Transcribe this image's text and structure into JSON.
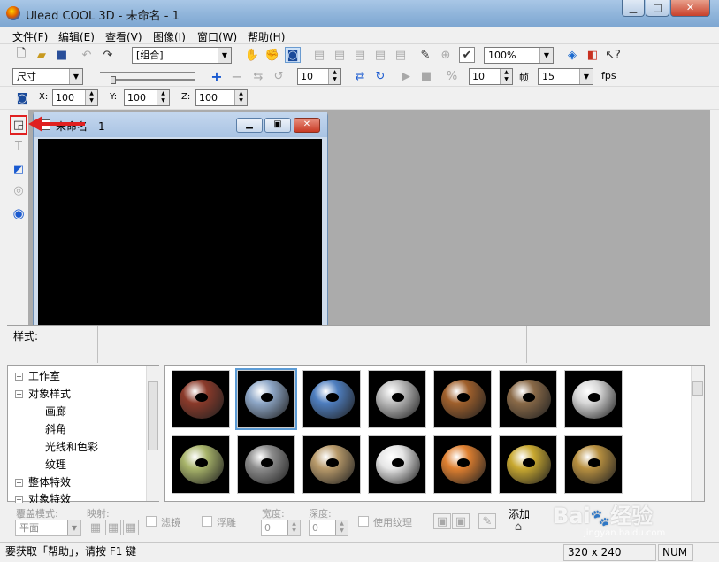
{
  "window": {
    "title": "Ulead COOL 3D - 未命名 - 1"
  },
  "menu": [
    "文件(F)",
    "编辑(E)",
    "查看(V)",
    "图像(I)",
    "窗口(W)",
    "帮助(H)"
  ],
  "toolbar1": {
    "object_select": "[组合]",
    "zoom": "100%"
  },
  "toolbar2": {
    "mode_select": "尺寸",
    "frame_spin": "10",
    "step_spin": "10",
    "frame_label": "帧",
    "fps_value": "15",
    "fps_label": "fps"
  },
  "toolbar3": {
    "x_label": "X:",
    "x_value": "100",
    "y_label": "Y:",
    "y_value": "100",
    "z_label": "Z:",
    "z_value": "100"
  },
  "child_window": {
    "title": "未命名 - 1"
  },
  "style_panel": {
    "label": "样式:"
  },
  "tree": {
    "items": [
      "工作室",
      "对象样式",
      "画廊",
      "斜角",
      "光线和色彩",
      "纹理",
      "整体特效",
      "对象特效"
    ]
  },
  "gallery": {
    "thumbs": [
      {
        "name": "brick",
        "color": "#8b3a2a"
      },
      {
        "name": "blue-marble",
        "color": "#8fa8c8"
      },
      {
        "name": "blue-stone",
        "color": "#4f7fc0"
      },
      {
        "name": "white-brick",
        "color": "#bdbdbd"
      },
      {
        "name": "woven",
        "color": "#a0602c"
      },
      {
        "name": "rock",
        "color": "#8a6a48"
      },
      {
        "name": "chrome-crack",
        "color": "#d8d8d8"
      },
      {
        "name": "green-stone",
        "color": "#a8b46a"
      },
      {
        "name": "grey-granite",
        "color": "#8c8c8c"
      },
      {
        "name": "sand",
        "color": "#b89a6a"
      },
      {
        "name": "chrome",
        "color": "#e6e6e6"
      },
      {
        "name": "orange",
        "color": "#e08030"
      },
      {
        "name": "gold",
        "color": "#c8a830"
      },
      {
        "name": "gold2",
        "color": "#b89040"
      }
    ]
  },
  "bottom_bar": {
    "overlay_mode_label": "覆盖模式:",
    "overlay_mode_value": "平面",
    "mapping_label": "映射:",
    "filter_label": "滤镜",
    "emboss_label": "浮雕",
    "width_label": "宽度:",
    "width_value": "0",
    "depth_label": "深度:",
    "depth_value": "0",
    "use_texture_label": "使用纹理",
    "add_label": "添加"
  },
  "status": {
    "help_text": "要获取「帮助」，请按 F1 键",
    "resolution": "320 x 240",
    "num": "NUM"
  },
  "watermark": {
    "text1": "Bai",
    "text2": "经验",
    "url": "jingyan.baidu.com"
  },
  "colors": {
    "accent_red": "#e02020",
    "titlebar": "#8fb4da"
  }
}
